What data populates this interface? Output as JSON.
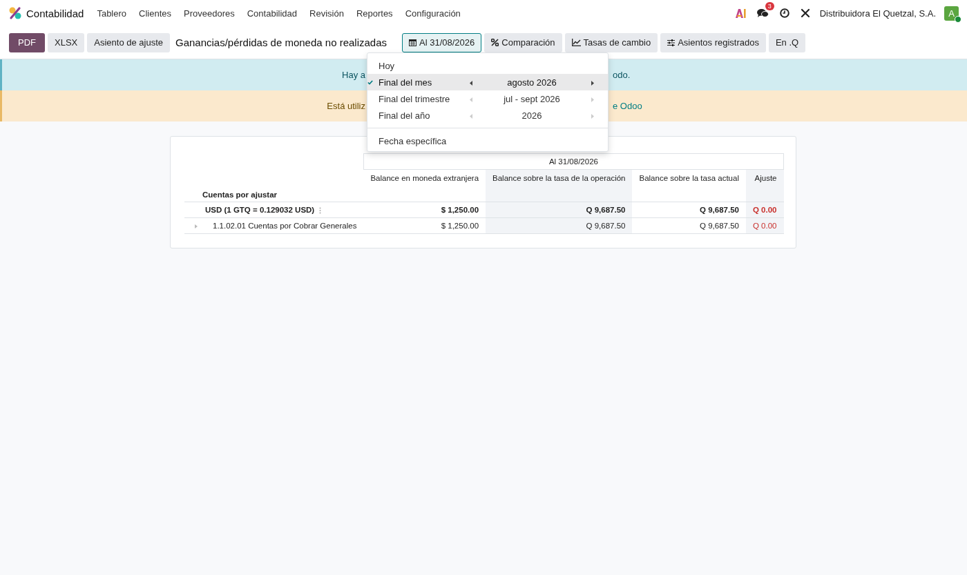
{
  "navbar": {
    "app_name": "Contabilidad",
    "menu": [
      "Tablero",
      "Clientes",
      "Proveedores",
      "Contabilidad",
      "Revisión",
      "Reportes",
      "Configuración"
    ],
    "chat_badge": "3",
    "company": "Distribuidora El Quetzal, S.A.",
    "avatar_letter": "A",
    "online": true
  },
  "toolbar": {
    "buttons": [
      {
        "label": "PDF",
        "kind": "primary"
      },
      {
        "label": "XLSX",
        "kind": "secondary"
      },
      {
        "label": "Asiento de ajuste",
        "kind": "secondary"
      }
    ],
    "title": "Ganancias/pérdidas de moneda no realizadas",
    "filters": [
      {
        "label": "Al 31/08/2026",
        "open": true
      },
      {
        "label": "Comparación",
        "open": false
      },
      {
        "label": "Tasas de cambio",
        "open": false
      },
      {
        "label": "Asientos registrados",
        "open": false
      },
      {
        "label": "En .Q",
        "open": false
      }
    ]
  },
  "date_menu": {
    "items": [
      {
        "label": "Hoy",
        "kind": "plain",
        "selected": false
      },
      {
        "label": "Final del mes",
        "kind": "period",
        "period": "agosto 2026",
        "selected": true
      },
      {
        "label": "Final del trimestre",
        "kind": "period",
        "period": "jul - sept 2026",
        "selected": false
      },
      {
        "label": "Final del año",
        "kind": "period",
        "period": "2026",
        "selected": false
      },
      {
        "label": "Fecha específica",
        "kind": "plain",
        "selected": false
      }
    ]
  },
  "banners": [
    {
      "kind": "info",
      "text_left": "Hay a",
      "text_right": "odo."
    },
    {
      "kind": "warning",
      "text_left": "Está utiliz",
      "link_right": "e Odoo"
    }
  ],
  "table": {
    "period_header": "Al 31/08/2026",
    "section_label": "Cuentas por ajustar",
    "columns": [
      {
        "label": "Balance en moneda extranjera"
      },
      {
        "label": "Balance sobre la tasa de la operación"
      },
      {
        "label": "Balance sobre la tasa actual"
      },
      {
        "label": "Ajuste"
      }
    ],
    "rows": [
      {
        "kind": "group",
        "name": "USD (1 GTQ = 0.129032 USD)",
        "values": [
          "$ 1,250.00",
          "Q 9,687.50",
          "Q 9,687.50",
          "Q 0.00"
        ]
      },
      {
        "kind": "account",
        "name": "1.1.02.01 Cuentas por Cobrar Generales",
        "values": [
          "$ 1,250.00",
          "Q 9,687.50",
          "Q 9,687.50",
          "Q 0.00"
        ]
      }
    ]
  }
}
